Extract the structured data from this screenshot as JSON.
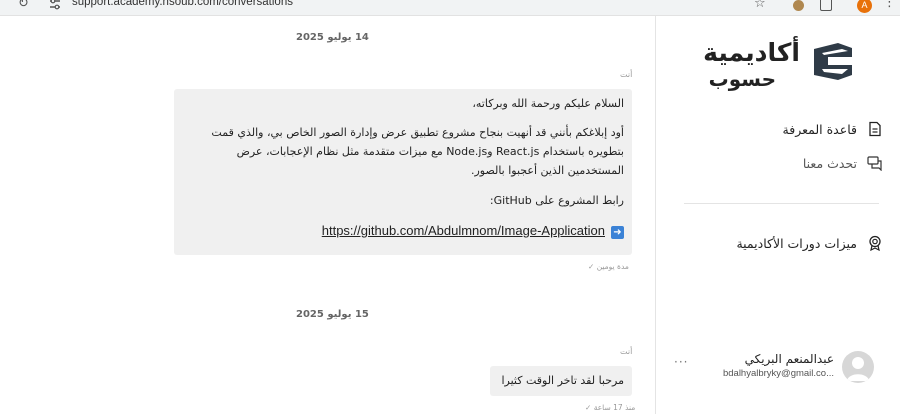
{
  "browser": {
    "url": "support.academy.hsoub.com/conversations",
    "profile_initial": "A"
  },
  "sidebar": {
    "logo": {
      "title": "أكاديمية",
      "subtitle": "حسوب"
    },
    "nav": [
      {
        "label": "قاعدة المعرفة",
        "icon": "document-icon"
      },
      {
        "label": "تحدث معنا",
        "icon": "chat-icon"
      },
      {
        "label": "ميزات دورات الأكاديمية",
        "icon": "award-icon"
      }
    ],
    "user": {
      "name": "عبدالمنعم البريكي",
      "email": "bdalhyalbryky@gmail.co..."
    }
  },
  "chat": {
    "dates": [
      "14 يوليو 2025",
      "15 يوليو 2025"
    ],
    "messages": [
      {
        "sender": "أنت",
        "greeting": "السلام عليكم ورحمة الله وبركاته،",
        "body": "أود إبلاغكم بأنني قد أنهيت بنجاح مشروع تطبيق عرض وإدارة الصور الخاص بي، والذي قمت بتطويره باستخدام React.js وNode.js مع ميزات متقدمة مثل نظام الإعجابات، عرض المستخدمين الذين أعجبوا بالصور.",
        "link_intro": "رابط المشروع على GitHub:",
        "link": "https://github.com/Abdulmnom/Image-Application",
        "status": "مدة يومين"
      },
      {
        "sender": "أنت",
        "body": "مرحبا لقد تاخر الوقت كثيرا",
        "status": "منذ 17 ساعة"
      }
    ]
  }
}
